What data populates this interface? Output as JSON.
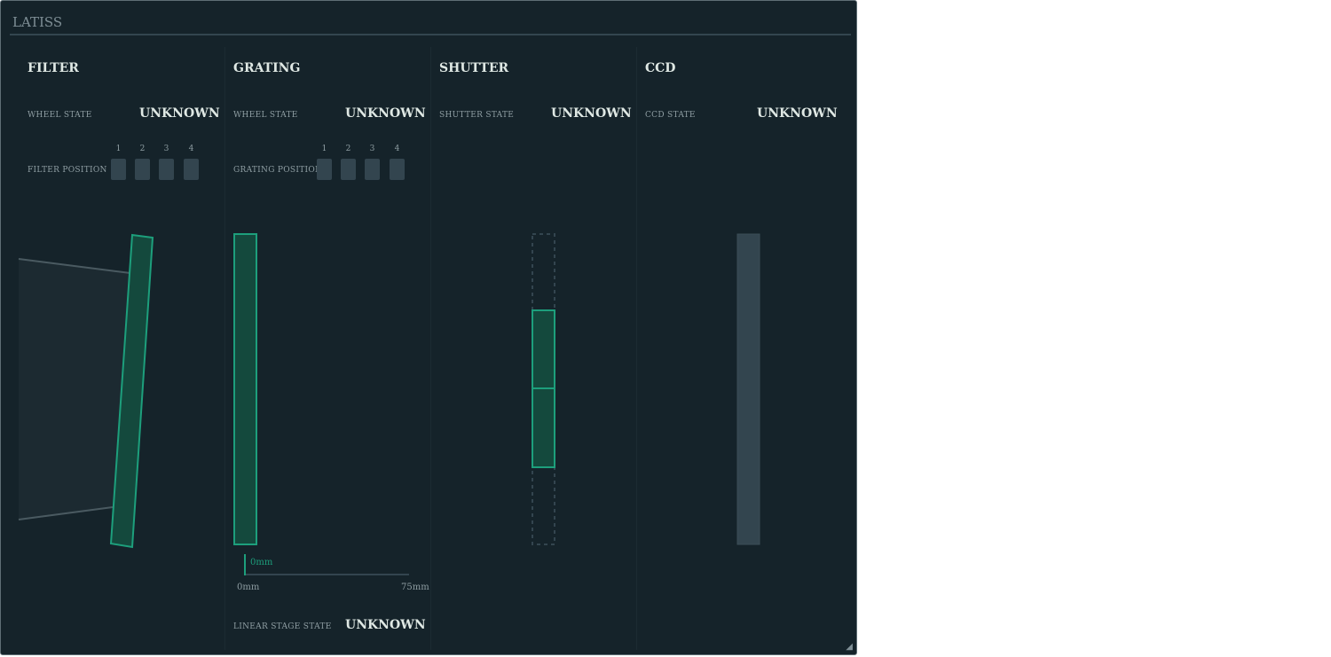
{
  "panel": {
    "title": "LATISS"
  },
  "colors": {
    "background": "#15232a",
    "accent": "#1d9f7c",
    "slot": "#33454f",
    "text": "#dfe8e4"
  },
  "filter": {
    "title": "FILTER",
    "wheel_state_label": "WHEEL STATE",
    "wheel_state_value": "UNKNOWN",
    "position_label": "FILTER POSITION",
    "positions": [
      "1",
      "2",
      "3",
      "4"
    ]
  },
  "grating": {
    "title": "GRATING",
    "wheel_state_label": "WHEEL STATE",
    "wheel_state_value": "UNKNOWN",
    "position_label": "GRATING POSITION",
    "positions": [
      "1",
      "2",
      "3",
      "4"
    ],
    "axis_min": "0mm",
    "axis_max": "75mm",
    "axis_current": "0mm",
    "linear_stage_label": "LINEAR STAGE STATE",
    "linear_stage_value": "UNKNOWN"
  },
  "shutter": {
    "title": "SHUTTER",
    "state_label": "SHUTTER STATE",
    "state_value": "UNKNOWN"
  },
  "ccd": {
    "title": "CCD",
    "state_label": "CCD STATE",
    "state_value": "UNKNOWN"
  }
}
